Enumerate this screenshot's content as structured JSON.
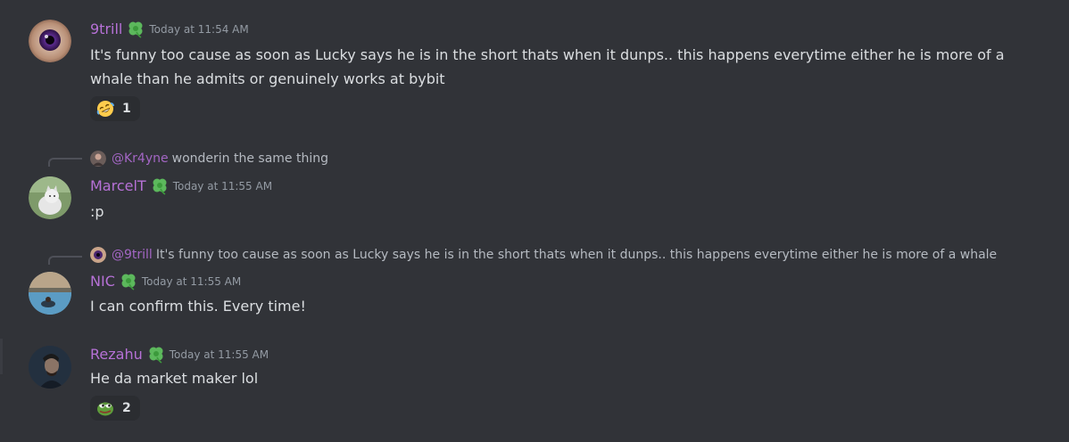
{
  "messages": [
    {
      "username": "9trill",
      "timestamp": "Today at 11:54 AM",
      "text": "It's funny too cause as soon as Lucky says he is in the short thats when it dunps.. this happens everytime either he is more of a whale than he admits or genuinely works at bybit",
      "reaction": {
        "emoji": "rofl-emoji",
        "count": "1"
      }
    },
    {
      "reply": {
        "user": "@Kr4yne",
        "text": "wonderin the same thing"
      },
      "username": "MarcelT",
      "timestamp": "Today at 11:55 AM",
      "text": ":p"
    },
    {
      "reply": {
        "user": "@9trill",
        "text": "It's funny too cause as soon as Lucky says he is in the short thats when it dunps.. this happens everytime either he is more of a whale"
      },
      "username": "NIC",
      "timestamp": "Today at 11:55 AM",
      "text": "I can confirm this. Every time!"
    },
    {
      "username": "Rezahu",
      "timestamp": "Today at 11:55 AM",
      "text": "He da market maker lol",
      "reaction": {
        "emoji": "pepe-emoji",
        "count": "2"
      }
    }
  ],
  "colors": {
    "background": "#313338",
    "username": "#b671d6",
    "text": "#dbdee1",
    "timestamp": "#949ba4",
    "reaction_bg": "#2b2d31"
  }
}
